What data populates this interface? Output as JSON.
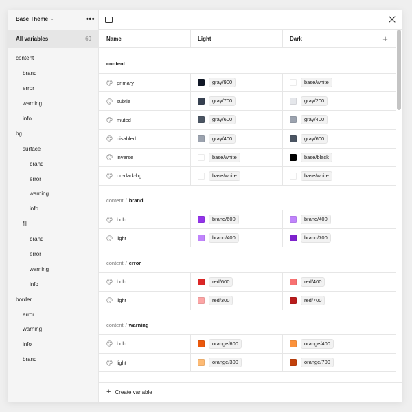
{
  "sidebar": {
    "theme_title": "Base Theme",
    "all_label": "All variables",
    "all_count": "69",
    "groups": [
      {
        "label": "content",
        "level": 0
      },
      {
        "label": "brand",
        "level": 1
      },
      {
        "label": "error",
        "level": 1
      },
      {
        "label": "warning",
        "level": 1
      },
      {
        "label": "info",
        "level": 1
      },
      {
        "label": "bg",
        "level": 0
      },
      {
        "label": "surface",
        "level": 1
      },
      {
        "label": "brand",
        "level": 2
      },
      {
        "label": "error",
        "level": 2
      },
      {
        "label": "warning",
        "level": 2
      },
      {
        "label": "info",
        "level": 2
      },
      {
        "label": "fill",
        "level": 1
      },
      {
        "label": "brand",
        "level": 2
      },
      {
        "label": "error",
        "level": 2
      },
      {
        "label": "warning",
        "level": 2
      },
      {
        "label": "info",
        "level": 2
      },
      {
        "label": "border",
        "level": 0
      },
      {
        "label": "error",
        "level": 1
      },
      {
        "label": "warning",
        "level": 1
      },
      {
        "label": "info",
        "level": 1
      },
      {
        "label": "brand",
        "level": 1
      }
    ]
  },
  "table": {
    "headers": {
      "name": "Name",
      "light": "Light",
      "dark": "Dark",
      "add": "+"
    },
    "sections": [
      {
        "parent": "",
        "label": "content",
        "rows": [
          {
            "name": "primary",
            "light": {
              "value": "gray/900",
              "color": "#111827"
            },
            "dark": {
              "value": "base/white",
              "color": "#ffffff"
            }
          },
          {
            "name": "subtle",
            "light": {
              "value": "gray/700",
              "color": "#374151"
            },
            "dark": {
              "value": "gray/200",
              "color": "#e5e7eb"
            }
          },
          {
            "name": "muted",
            "light": {
              "value": "gray/600",
              "color": "#4b5563"
            },
            "dark": {
              "value": "gray/400",
              "color": "#9ca3af"
            }
          },
          {
            "name": "disabled",
            "light": {
              "value": "gray/400",
              "color": "#9ca3af"
            },
            "dark": {
              "value": "gray/600",
              "color": "#4b5563"
            }
          },
          {
            "name": "inverse",
            "light": {
              "value": "base/white",
              "color": "#ffffff"
            },
            "dark": {
              "value": "base/black",
              "color": "#000000"
            }
          },
          {
            "name": "on-dark-bg",
            "light": {
              "value": "base/white",
              "color": "#ffffff"
            },
            "dark": {
              "value": "base/white",
              "color": "#ffffff"
            }
          }
        ]
      },
      {
        "parent": "content",
        "label": "brand",
        "rows": [
          {
            "name": "bold",
            "light": {
              "value": "brand/600",
              "color": "#9333ea"
            },
            "dark": {
              "value": "brand/400",
              "color": "#c084fc"
            }
          },
          {
            "name": "light",
            "light": {
              "value": "brand/400",
              "color": "#c084fc"
            },
            "dark": {
              "value": "brand/700",
              "color": "#7e22ce"
            }
          }
        ]
      },
      {
        "parent": "content",
        "label": "error",
        "rows": [
          {
            "name": "bold",
            "light": {
              "value": "red/600",
              "color": "#dc2626"
            },
            "dark": {
              "value": "red/400",
              "color": "#f87171"
            }
          },
          {
            "name": "light",
            "light": {
              "value": "red/300",
              "color": "#fca5a5"
            },
            "dark": {
              "value": "red/700",
              "color": "#b91c1c"
            }
          }
        ]
      },
      {
        "parent": "content",
        "label": "warning",
        "rows": [
          {
            "name": "bold",
            "light": {
              "value": "orange/600",
              "color": "#ea580c"
            },
            "dark": {
              "value": "orange/400",
              "color": "#fb923c"
            }
          },
          {
            "name": "light",
            "light": {
              "value": "orange/300",
              "color": "#fdba74"
            },
            "dark": {
              "value": "orange/700",
              "color": "#c2410c"
            }
          }
        ]
      }
    ]
  },
  "footer": {
    "create_label": "Create variable"
  },
  "icons": {
    "more": "more-horizontal-icon",
    "panel": "sidebar-panel-icon",
    "close": "close-icon",
    "variable": "color-palette-icon"
  }
}
